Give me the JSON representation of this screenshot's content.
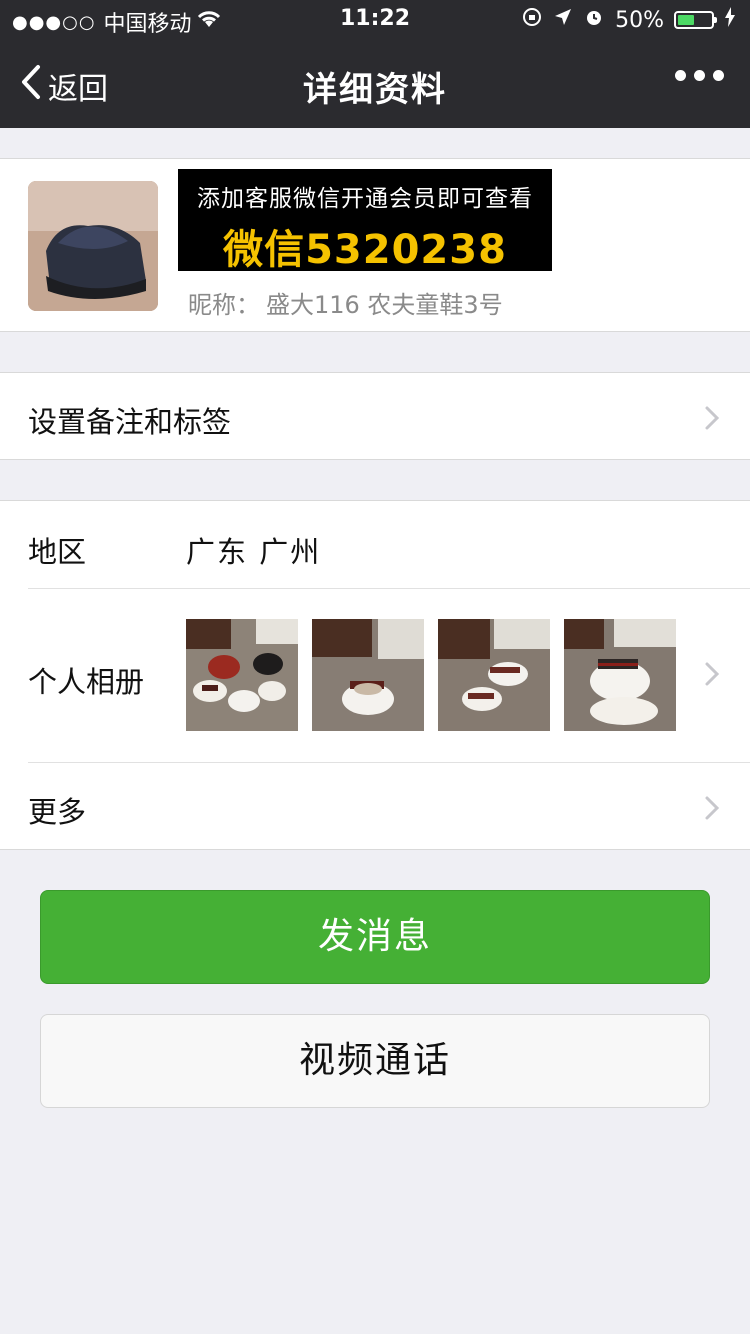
{
  "status_bar": {
    "signal": "●●●○○",
    "carrier": "中国移动",
    "time": "11:22",
    "battery": "50%",
    "battery_level": 0.5
  },
  "nav": {
    "back_label": "返回",
    "title": "详细资料",
    "more_icon": "ellipsis-icon"
  },
  "profile": {
    "banner_line1": "添加客服微信开通会员即可查看",
    "banner_line2": "微信5320238",
    "nickname_label": "昵称：",
    "nickname_value": "盛大116  农夫童鞋3号"
  },
  "remark": {
    "label": "设置备注和标签"
  },
  "info": {
    "region_label": "地区",
    "region_value": "广东 广州",
    "album_label": "个人相册",
    "more_label": "更多"
  },
  "buttons": {
    "message": "发消息",
    "video_call": "视频通话"
  },
  "colors": {
    "nav_bg": "#2b2b2f",
    "accent_green": "#45b035",
    "banner_yellow": "#f5c200",
    "page_bg": "#efeff4"
  }
}
